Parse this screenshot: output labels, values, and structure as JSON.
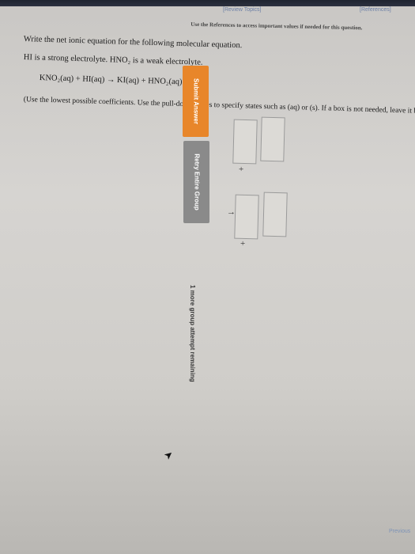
{
  "header": {
    "review_topics": "[Review Topics]",
    "references": "[References]",
    "ref_note": "Use the References to access important values if needed for this question."
  },
  "question": {
    "line1": "Write the net ionic equation for the following molecular equation.",
    "line2": "HI is a strong electrolyte. HNO₂ is a weak electrolyte.",
    "equation": "KNO₂(aq) + HI(aq) → KI(aq) + HNO₂(aq)",
    "instructions": "(Use the lowest possible coefficients. Use the pull-down boxes to specify states such as (aq) or (s). If a box is not needed, leave it blank.)"
  },
  "answer": {
    "plus": "+",
    "arrow": "→"
  },
  "buttons": {
    "submit": "Submit Answer",
    "retry": "Retry Entire Group"
  },
  "attempts": "1 more group attempt remaining",
  "nav": {
    "previous": "Previous"
  },
  "colors": {
    "button_orange": "#e8862a",
    "button_gray": "#8a8a8a",
    "topbar": "#252a36"
  }
}
